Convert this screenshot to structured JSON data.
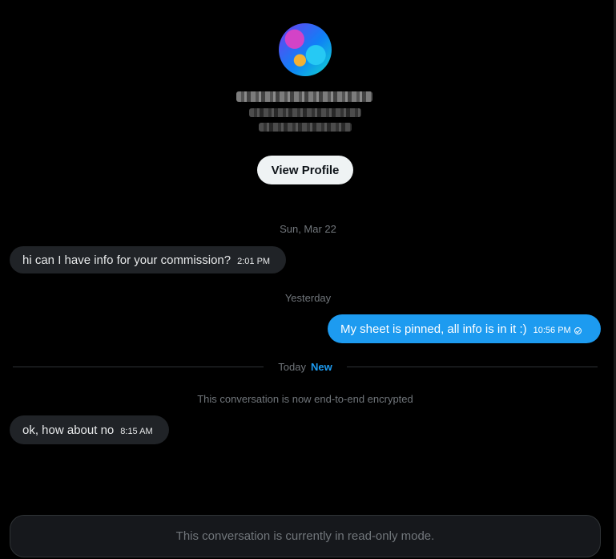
{
  "profile": {
    "view_profile_label": "View Profile"
  },
  "conversation": {
    "date_1": "Sun, Mar 22",
    "date_2": "Yesterday",
    "messages": [
      {
        "text": "hi can I have info for your commission?",
        "time": "2:01 PM",
        "direction": "incoming"
      },
      {
        "text": "My sheet is pinned, all info is in it :)",
        "time": "10:56 PM",
        "direction": "outgoing"
      },
      {
        "text": "ok, how about no",
        "time": "8:15 AM",
        "direction": "incoming"
      }
    ],
    "today_label": "Today",
    "new_label": "New",
    "encrypted_note": "This conversation is now end-to-end encrypted"
  },
  "footer": {
    "readonly_text": "This conversation is currently in read-only mode."
  },
  "colors": {
    "background": "#000000",
    "incoming_bubble": "#202327",
    "outgoing_bubble": "#1d9bf0",
    "accent": "#1d9bf0",
    "muted_text": "#71767b"
  }
}
